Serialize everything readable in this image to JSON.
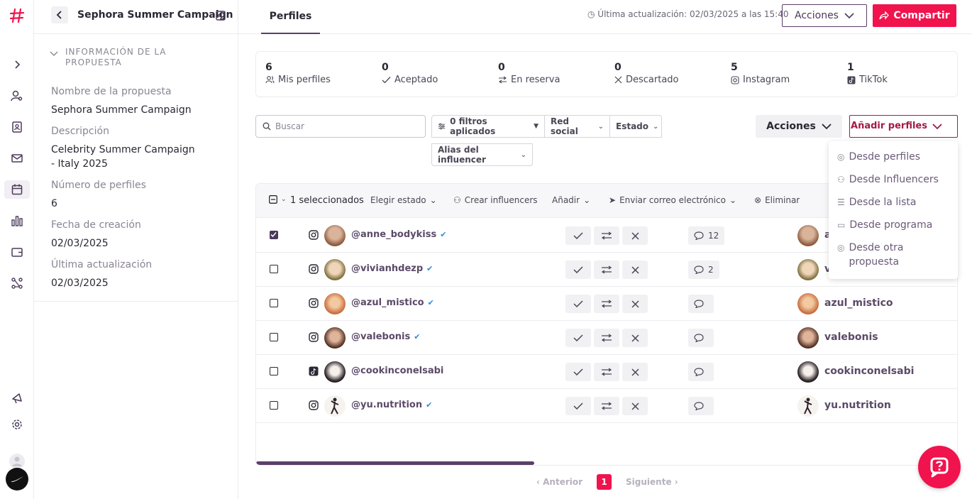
{
  "header": {
    "title": "Sephora Summer Campaign",
    "tab": "Perfiles",
    "last_update": "Última actualización: 02/03/2025 a las 15:40",
    "actions_label": "Acciones",
    "share_label": "Compartir"
  },
  "info": {
    "section_title": "INFORMACIÓN DE LA PROPUESTA",
    "fields": [
      {
        "label": "Nombre de la propuesta",
        "value": "Sephora Summer Campaign"
      },
      {
        "label": "Descripción",
        "value": "Celebrity Summer Campaign - Italy 2025"
      },
      {
        "label": "Número de perfiles",
        "value": "6"
      },
      {
        "label": "Fecha de creación",
        "value": "02/03/2025"
      },
      {
        "label": "Última actualización",
        "value": "02/03/2025"
      }
    ]
  },
  "stats": [
    {
      "num": "6",
      "label": "Mis perfiles",
      "icon": "users-icon"
    },
    {
      "num": "0",
      "label": "Aceptado",
      "icon": "check-icon"
    },
    {
      "num": "0",
      "label": "En reserva",
      "icon": "swap-icon"
    },
    {
      "num": "0",
      "label": "Descartado",
      "icon": "x-icon"
    },
    {
      "num": "5",
      "label": "Instagram",
      "icon": "instagram-icon"
    },
    {
      "num": "1",
      "label": "TikTok",
      "icon": "tiktok-icon"
    }
  ],
  "toolbar": {
    "search_placeholder": "Buscar",
    "filters_label": "0 filtros aplicados",
    "social_label": "Red social",
    "state_label": "Estado",
    "alias_label": "Alias del influencer",
    "actions_label": "Acciones",
    "add_label": "Añadir perfiles"
  },
  "add_menu": [
    "Desde perfiles",
    "Desde Influencers",
    "Desde la lista",
    "Desde programa",
    "Desde otra propuesta"
  ],
  "table_header": {
    "selected": "1 seleccionados",
    "choose_state": "Elegir estado",
    "create": "Crear influencers",
    "add": "Añadir",
    "email": "Enviar correo electrónico",
    "delete": "Eliminar"
  },
  "rows": [
    {
      "handle": "@anne_bodykiss",
      "name": "a",
      "social": "instagram",
      "comments": "12",
      "checked": true,
      "verified": true
    },
    {
      "handle": "@vivianhdezp",
      "name": "v",
      "social": "instagram",
      "comments": "2",
      "checked": false,
      "verified": true
    },
    {
      "handle": "@azul_mistico",
      "name": "azul_mistico",
      "social": "instagram",
      "comments": "",
      "checked": false,
      "verified": true
    },
    {
      "handle": "@valebonis",
      "name": "valebonis",
      "social": "instagram",
      "comments": "",
      "checked": false,
      "verified": true
    },
    {
      "handle": "@cookinconelsabi",
      "name": "cookinconelsabi",
      "social": "tiktok",
      "comments": "",
      "checked": false,
      "verified": false
    },
    {
      "handle": "@yu.nutrition",
      "name": "yu.nutrition",
      "social": "instagram",
      "comments": "",
      "checked": false,
      "verified": true
    }
  ],
  "pager": {
    "prev": "Anterior",
    "page": "1",
    "next": "Siguiente"
  },
  "colors": {
    "accent": "#f0134d",
    "primary": "#5b3f6b"
  }
}
